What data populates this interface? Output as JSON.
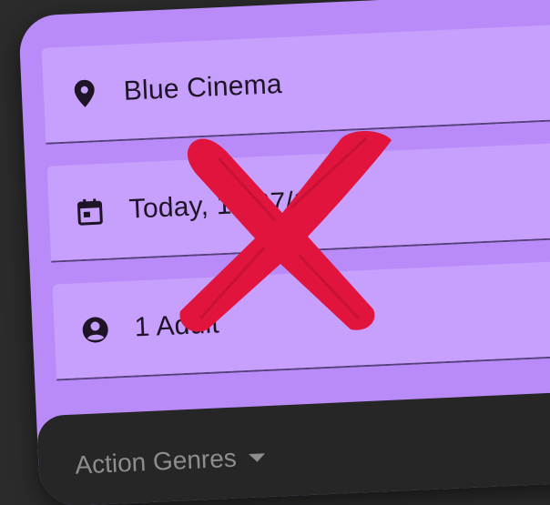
{
  "fields": {
    "location": {
      "value": "Blue Cinema",
      "icon": "location-pin-icon"
    },
    "date": {
      "value": "Today, 10/07/18",
      "icon": "calendar-icon"
    },
    "tickets": {
      "value": "1 Adult",
      "icon": "person-circle-icon"
    }
  },
  "genre_dropdown": {
    "label": "Action Genres",
    "icon": "dropdown-caret-icon"
  },
  "overlay": {
    "icon": "red-x-cross-icon",
    "color": "#e0143c"
  },
  "colors": {
    "card": "#b98bf8",
    "field": "#c79ffd",
    "panel": "#262626",
    "background": "#2b2b2b"
  }
}
